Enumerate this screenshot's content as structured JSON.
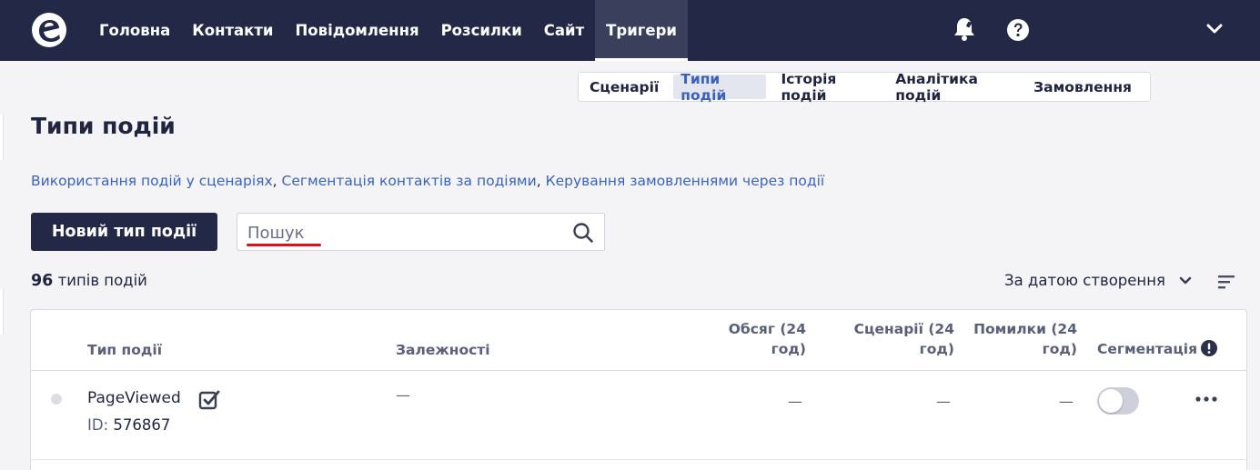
{
  "nav": {
    "items": [
      "Головна",
      "Контакти",
      "Повідомлення",
      "Розсилки",
      "Сайт",
      "Тригери"
    ],
    "active_index": 5
  },
  "subtabs": {
    "items": [
      "Сценарії",
      "Типи подій",
      "Історія подій",
      "Аналітика подій",
      "Замовлення"
    ],
    "active_index": 1
  },
  "page": {
    "title": "Типи подій",
    "links": [
      "Використання подій у сценаріях",
      "Сегментація контактів за подіями",
      "Керування замовленнями через події"
    ],
    "link_separator": ", "
  },
  "toolbar": {
    "new_button_label": "Новий тип події",
    "search_placeholder": "Пошук",
    "search_value": ""
  },
  "summary": {
    "count": "96",
    "count_suffix": "типів подій",
    "sort_label": "За датою створення"
  },
  "table": {
    "headers": {
      "event_type": "Тип події",
      "dependencies": "Залежності",
      "volume_l1": "Обсяг (24",
      "volume_l2": "год)",
      "scenarios_l1": "Сценарії (24",
      "scenarios_l2": "год)",
      "errors_l1": "Помилки (24",
      "errors_l2": "год)",
      "segmentation": "Сегментація"
    },
    "rows": [
      {
        "name": "PageViewed",
        "id_label": "ID:",
        "id": "576867",
        "dependencies": "—",
        "volume": "—",
        "scenarios": "—",
        "errors": "—",
        "segmentation_on": false
      }
    ]
  },
  "icons": [
    "logo-icon",
    "bell-icon",
    "help-icon",
    "chevron-down-icon",
    "search-icon",
    "sort-lines-icon",
    "checkbox-icon",
    "info-icon",
    "more-icon"
  ],
  "colors": {
    "topbar": "#222845",
    "link": "#3a62c0",
    "search_underline": "#e10f16",
    "active_subtab_text": "#3b62b8"
  }
}
